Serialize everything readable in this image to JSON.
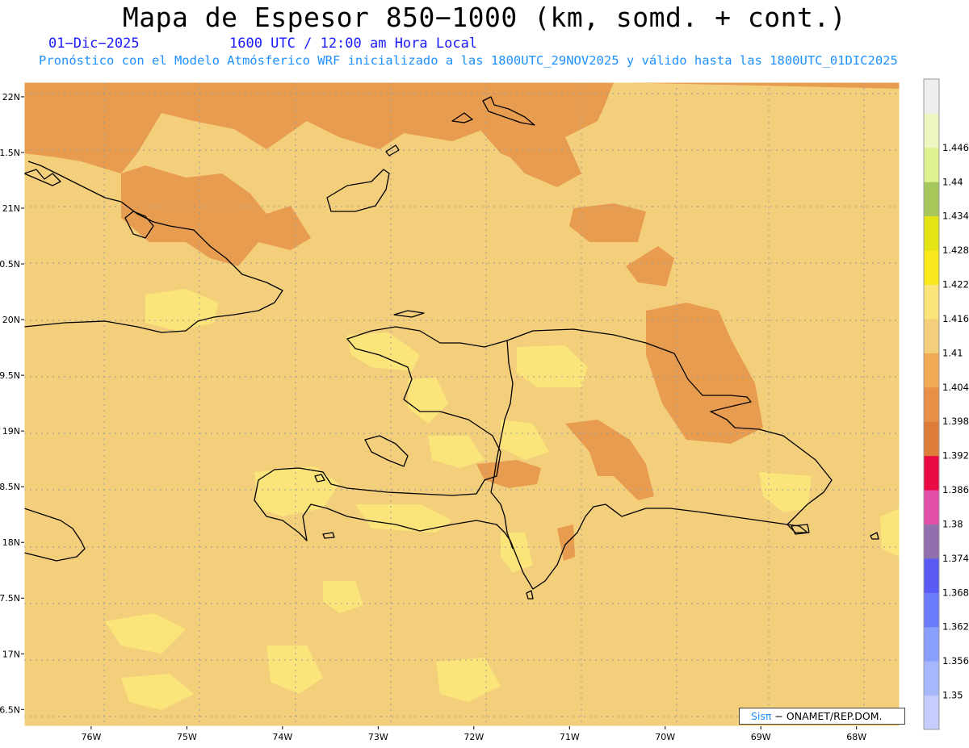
{
  "header": {
    "title": "Mapa de Espesor 850−1000 (km, somd. + cont.)",
    "date": "01−Dic−2025",
    "time": "1600 UTC / 12:00 am Hora Local",
    "description": "Pronóstico con el Modelo Atmósferico WRF inicializado a las 1800UTC_29NOV2025 y válido hasta las  1800UTC_01DIC2025",
    "title_color": "#000000",
    "subtitle_color": "#1a1aff",
    "description_color": "#1e90ff"
  },
  "map": {
    "lon_range": [
      -76.7,
      -67.55
    ],
    "lat_range": [
      16.35,
      22.13
    ],
    "lon_labels": [
      {
        "lon": -76,
        "label": "76W"
      },
      {
        "lon": -75,
        "label": "75W"
      },
      {
        "lon": -74,
        "label": "74W"
      },
      {
        "lon": -73,
        "label": "73W"
      },
      {
        "lon": -72,
        "label": "72W"
      },
      {
        "lon": -71,
        "label": "71W"
      },
      {
        "lon": -70,
        "label": "70W"
      },
      {
        "lon": -69,
        "label": "69W"
      },
      {
        "lon": -68,
        "label": "68W"
      }
    ],
    "lat_labels": [
      {
        "lat": 22,
        "label": "22N"
      },
      {
        "lat": 21.5,
        "label": "1.5N"
      },
      {
        "lat": 21,
        "label": "21N"
      },
      {
        "lat": 20.5,
        "label": "0.5N"
      },
      {
        "lat": 20,
        "label": "20N"
      },
      {
        "lat": 19.5,
        "label": "9.5N"
      },
      {
        "lat": 19,
        "label": "19N"
      },
      {
        "lat": 18.5,
        "label": "8.5N"
      },
      {
        "lat": 18,
        "label": "18N"
      },
      {
        "lat": 17.5,
        "label": "7.5N"
      },
      {
        "lat": 17,
        "label": "17N"
      },
      {
        "lat": 16.5,
        "label": "6.5N"
      }
    ],
    "background_color": "#f3cf7c",
    "grid_color": "#9a9a9a",
    "coast_color": "#000000"
  },
  "colorbar": {
    "colors": [
      "#c4cdfc",
      "#a7b7fc",
      "#8a9efc",
      "#6a7bfc",
      "#5a5af5",
      "#9270ad",
      "#e34fa8",
      "#ea0a44",
      "#de7c3a",
      "#e89047",
      "#f0aa54",
      "#f3cf7c",
      "#fbe57a",
      "#f8e81c",
      "#e4e414",
      "#a6c85a",
      "#ddf290",
      "#eef5c0",
      "#eeeeee"
    ],
    "labels": [
      "1.35",
      "1.356",
      "1.362",
      "1.368",
      "1.374",
      "1.38",
      "1.386",
      "1.392",
      "1.398",
      "1.404",
      "1.41",
      "1.416",
      "1.422",
      "1.428",
      "1.434",
      "1.44",
      "1.446"
    ]
  },
  "credit": {
    "logo": "Sisπ",
    "text": " − ONAMET/REP.DOM."
  }
}
